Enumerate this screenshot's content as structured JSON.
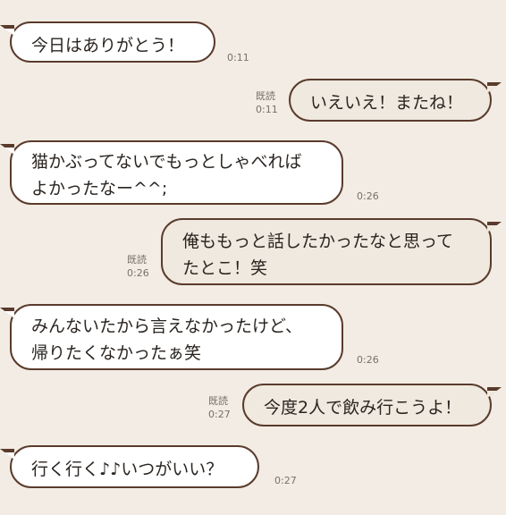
{
  "messages": [
    {
      "side": "in",
      "lines": [
        "今日はありがとう！"
      ],
      "time": "0:11"
    },
    {
      "side": "out",
      "lines": [
        "いえいえ！またね！"
      ],
      "read": "既読",
      "time": "0:11"
    },
    {
      "side": "in",
      "lines": [
        "猫かぶってないでもっとしゃべれば",
        "よかったなー^^;"
      ],
      "time": "0:26"
    },
    {
      "side": "out",
      "lines": [
        "俺ももっと話したかったなと思って",
        "たとこ！笑"
      ],
      "read": "既読",
      "time": "0:26"
    },
    {
      "side": "in",
      "lines": [
        "みんないたから言えなかったけど、",
        "帰りたくなかったぁ笑"
      ],
      "time": "0:26"
    },
    {
      "side": "out",
      "lines": [
        "今度2人で飲み行こうよ！"
      ],
      "read": "既読",
      "time": "0:27"
    },
    {
      "side": "in",
      "lines": [
        "行く行く♪♪いつがいい？"
      ],
      "time": "0:27"
    }
  ],
  "colors": {
    "background": "#f2ece4",
    "incoming_bubble": "#ffffff",
    "outgoing_bubble": "#efe9df",
    "border": "#5a3b2c"
  }
}
